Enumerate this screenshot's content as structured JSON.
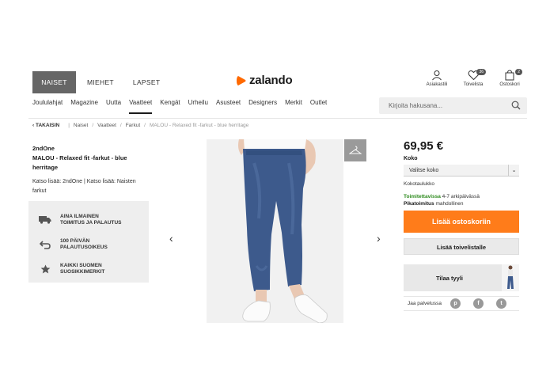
{
  "header": {
    "gender_tabs": [
      "NAISET",
      "MIEHET",
      "LAPSET"
    ],
    "logo_text": "zalando",
    "account_label": "Asiakastili",
    "wishlist_label": "Toivelista",
    "wishlist_count": "36",
    "cart_label": "Ostoskori",
    "cart_count": "2"
  },
  "nav": {
    "items": [
      "Joululahjat",
      "Magazine",
      "Uutta",
      "Vaatteet",
      "Kengät",
      "Urheilu",
      "Asusteet",
      "Designers",
      "Merkit",
      "Outlet"
    ],
    "active_index": 3
  },
  "search": {
    "placeholder": "Kirjoita hakusana..."
  },
  "breadcrumb": {
    "back": "TAKAISIN",
    "items": [
      "Naiset",
      "Vaatteet",
      "Farkut"
    ],
    "current": "MALOU - Relaxed fit -farkut - blue herritage"
  },
  "product": {
    "brand": "2ndOne",
    "title": "MALOU - Relaxed fit -farkut - blue herritage",
    "more_text": "Katso lisää: 2ndOne | Katso lisää: Naisten farkut",
    "price": "69,95 €",
    "size_label": "Koko",
    "size_select": "Valitse koko",
    "size_chart": "Kokotaulukko",
    "delivery_status": "Toimitettavissa",
    "delivery_time": " 4-7 arkipäivässä",
    "express": "Pikatoimitus",
    "express_note": " mahdollinen"
  },
  "benefits": [
    {
      "icon": "truck-icon",
      "text": "AINA ILMAINEN\nTOIMITUS JA PALAUTUS",
      "l1": "AINA ILMAINEN",
      "l2": "TOIMITUS JA PALAUTUS"
    },
    {
      "icon": "return-icon",
      "l1": "100 PÄIVÄN",
      "l2": "PALAUTUSOIKEUS"
    },
    {
      "icon": "star-icon",
      "l1": "KAIKKI SUOMEN",
      "l2": "SUOSIKKIMERKIT"
    }
  ],
  "buttons": {
    "add_to_cart": "Lisää ostoskoriin",
    "add_to_wishlist": "Lisää toivelistalle",
    "order_style": "Tilaa tyyli",
    "share": "Jaa palvelussa"
  },
  "gallery": {
    "prev": "‹",
    "next": "›"
  },
  "colors": {
    "accent": "#ff7c1a",
    "logo": "#ff6900",
    "in_stock": "#2e8b1e"
  }
}
